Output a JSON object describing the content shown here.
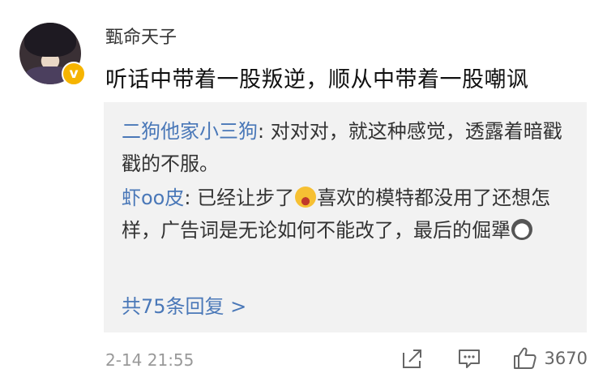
{
  "comment": {
    "username": "甄命天子",
    "text": "听话中带着一股叛逆，顺从中带着一股嘲讽",
    "timestamp": "2-14 21:55",
    "likes": "3670",
    "avatar_badge": "v"
  },
  "replies": [
    {
      "author": "二狗他家小三狗",
      "separator": ": ",
      "text_parts": [
        "对对对，就这种感觉，透露着暗戳戳的不服。"
      ]
    },
    {
      "author": "虾oo皮",
      "separator": ": ",
      "text_parts": [
        "已经让步了",
        "喜欢的模特都没用了还想怎样，广告词是无论如何不能改了，最后的倔犟"
      ],
      "emojis": [
        "laughing-emoji",
        "husky-dog-emoji"
      ]
    }
  ],
  "more_replies_label": "共75条回复 >",
  "icons": {
    "share": "share-icon",
    "reply": "comment-icon",
    "like": "thumbs-up-icon"
  },
  "colors": {
    "link_blue": "#4a78b8",
    "reply_bg": "#f2f2f2",
    "badge_gold": "#f6b400"
  }
}
